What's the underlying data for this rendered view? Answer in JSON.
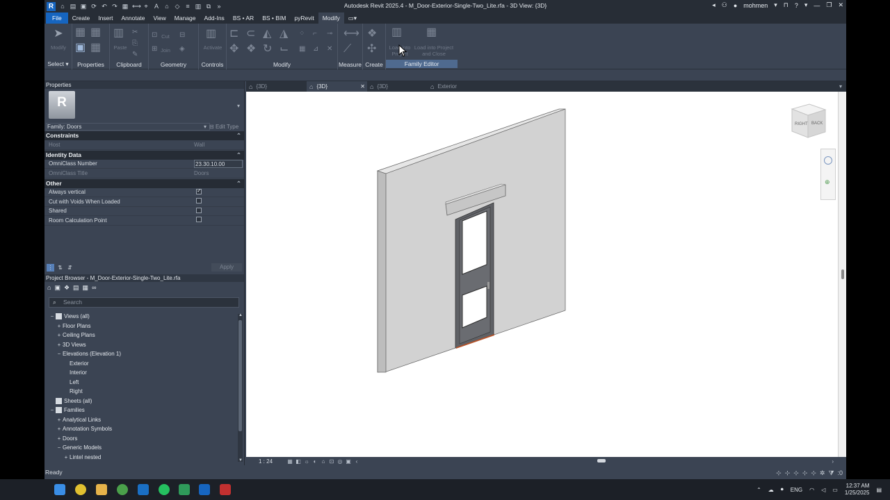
{
  "app": {
    "logo_letter": "R",
    "title": "Autodesk Revit 2025.4 - M_Door-Exterior-Single-Two_Lite.rfa - 3D View: {3D}",
    "user": "mohmen",
    "help": "?"
  },
  "menu": [
    "File",
    "Create",
    "Insert",
    "Annotate",
    "View",
    "Manage",
    "Add-Ins",
    "BS • AR",
    "BS • BIM",
    "pyRevit",
    "Modify"
  ],
  "menu_extra": "▭▾",
  "ribbon": {
    "panels": [
      "Select ▾",
      "Properties",
      "Clipboard",
      "Geometry",
      "Controls",
      "Modify",
      "Measure",
      "Create",
      "Family Editor"
    ],
    "modify_btn": "Modify",
    "paste_btn": "Paste",
    "cut_btn": "Cut",
    "join_btn": "Join",
    "activate_btn": "Activate",
    "load_project_btn": "Load into Project",
    "load_close_btn": "Load into Project and Close"
  },
  "properties": {
    "title": "Properties",
    "type_logo": "R",
    "family_label": "Family: Doors",
    "edit_type": "Edit Type",
    "sections": [
      {
        "name": "Constraints",
        "rows": [
          {
            "k": "Host",
            "v": "Wall",
            "dim": true
          }
        ]
      },
      {
        "name": "Identity Data",
        "rows": [
          {
            "k": "OmniClass Number",
            "v": "23.30.10.00",
            "editing": true
          },
          {
            "k": "OmniClass Title",
            "v": "Doors",
            "dim": true
          }
        ]
      },
      {
        "name": "Other",
        "rows": [
          {
            "k": "Always vertical",
            "check": true
          },
          {
            "k": "Cut with Voids When Loaded",
            "check": false
          },
          {
            "k": "Shared",
            "check": false
          },
          {
            "k": "Room Calculation Point",
            "check": false
          }
        ]
      }
    ],
    "apply": "Apply"
  },
  "browser": {
    "title": "Project Browser - M_Door-Exterior-Single-Two_Lite.rfa",
    "search_placeholder": "Search",
    "items": [
      {
        "label": "Views (all)",
        "level": 0,
        "ex": "−",
        "icon": true
      },
      {
        "label": "Floor Plans",
        "level": 1,
        "ex": "+"
      },
      {
        "label": "Ceiling Plans",
        "level": 1,
        "ex": "+"
      },
      {
        "label": "3D Views",
        "level": 1,
        "ex": "+"
      },
      {
        "label": "Elevations (Elevation 1)",
        "level": 1,
        "ex": "−"
      },
      {
        "label": "Exterior",
        "level": 2,
        "ex": ""
      },
      {
        "label": "Interior",
        "level": 2,
        "ex": ""
      },
      {
        "label": "Left",
        "level": 2,
        "ex": ""
      },
      {
        "label": "Right",
        "level": 2,
        "ex": ""
      },
      {
        "label": "Sheets (all)",
        "level": 0,
        "ex": "",
        "icon": true
      },
      {
        "label": "Families",
        "level": 0,
        "ex": "−",
        "icon": true
      },
      {
        "label": "Analytical Links",
        "level": 1,
        "ex": "+"
      },
      {
        "label": "Annotation Symbols",
        "level": 1,
        "ex": "+"
      },
      {
        "label": "Doors",
        "level": 1,
        "ex": "+"
      },
      {
        "label": "Generic Models",
        "level": 1,
        "ex": "−"
      },
      {
        "label": "Lintel nested",
        "level": 2,
        "ex": "+"
      }
    ]
  },
  "view_tabs": [
    {
      "label": "{3D}",
      "active": false
    },
    {
      "label": "{3D}",
      "active": true
    },
    {
      "label": "{3D}",
      "active": false
    },
    {
      "label": "Exterior",
      "active": false
    }
  ],
  "viewcube": {
    "right": "RIGHT",
    "back": "BACK"
  },
  "view_control": {
    "scale": "1 : 24"
  },
  "status": {
    "text": "Ready",
    "filter_count": ":0"
  },
  "tray": {
    "lang": "ENG",
    "time": "12:37 AM",
    "date": "1/25/2025"
  }
}
